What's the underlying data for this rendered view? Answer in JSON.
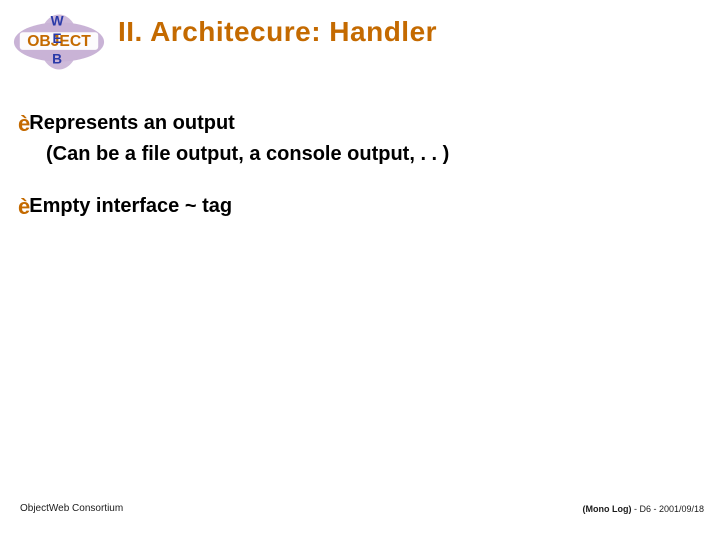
{
  "title": "II. Architecure: Handler",
  "bullets": [
    {
      "line1": "Represents an output",
      "line2": "(Can be a file output, a console output, . . )"
    },
    {
      "line1": "Empty interface ~ tag",
      "line2": ""
    }
  ],
  "footer": {
    "left": "ObjectWeb Consortium",
    "right_mono": "(Mono Log)",
    "right_meta": " - D6 - 2001/09/18"
  }
}
